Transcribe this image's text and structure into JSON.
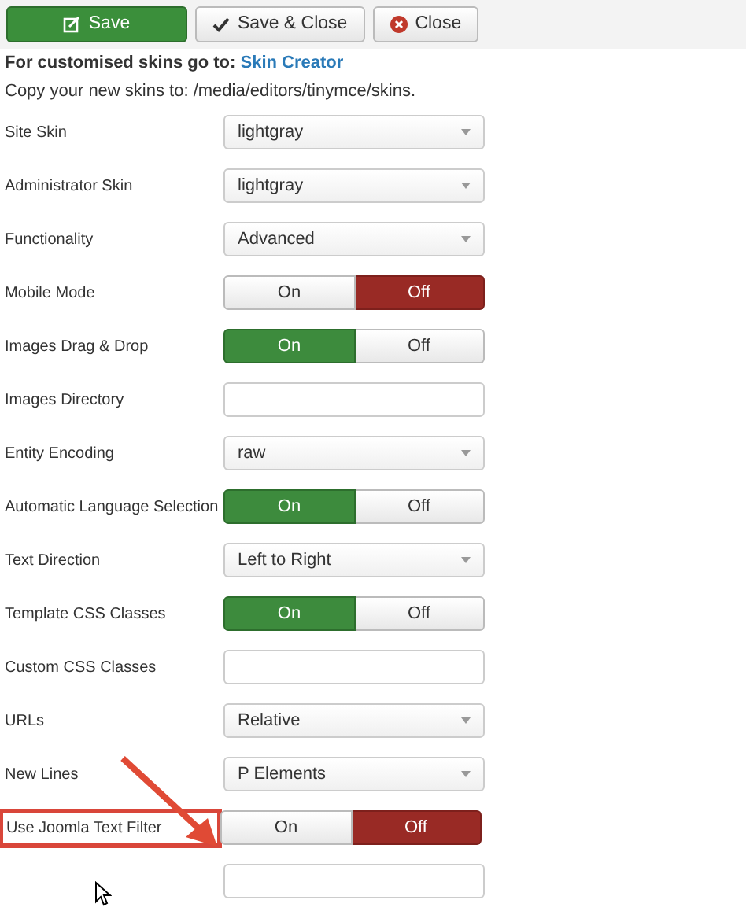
{
  "toolbar": [
    {
      "kind": "save",
      "label": "Save"
    },
    {
      "kind": "save-close",
      "label": "Save & Close"
    },
    {
      "kind": "close",
      "label": "Close"
    }
  ],
  "intro": {
    "text": "For customised skins go to:",
    "link": "Skin Creator"
  },
  "note": "Copy your new skins to: /media/editors/tinymce/skins.",
  "fields": [
    {
      "label": "Site Skin",
      "kind": "select",
      "value": "lightgray"
    },
    {
      "label": "Administrator Skin",
      "kind": "select",
      "value": "lightgray"
    },
    {
      "label": "Functionality",
      "kind": "select",
      "value": "Advanced"
    },
    {
      "label": "Mobile Mode",
      "kind": "toggle",
      "on_label": "On",
      "off_label": "Off",
      "on": false
    },
    {
      "label": "Images Drag & Drop",
      "kind": "toggle",
      "on_label": "On",
      "off_label": "Off",
      "on": true
    },
    {
      "label": "Images Directory",
      "kind": "text"
    },
    {
      "label": "Entity Encoding",
      "kind": "select",
      "value": "raw"
    },
    {
      "label": "Automatic Language Selection",
      "kind": "toggle",
      "on_label": "On",
      "off_label": "Off",
      "on": true
    },
    {
      "label": "Text Direction",
      "kind": "select",
      "value": "Left to Right"
    },
    {
      "label": "Template CSS Classes",
      "kind": "toggle",
      "on_label": "On",
      "off_label": "Off",
      "on": true
    },
    {
      "label": "Custom CSS Classes",
      "kind": "text"
    },
    {
      "label": "URLs",
      "kind": "select",
      "value": "Relative"
    },
    {
      "label": "New Lines",
      "kind": "select",
      "value": "P Elements"
    },
    {
      "label": "Use Joomla Text Filter",
      "kind": "toggle",
      "on_label": "On",
      "off_label": "Off",
      "on": false,
      "highlighted": true
    },
    {
      "kind": "text"
    }
  ]
}
